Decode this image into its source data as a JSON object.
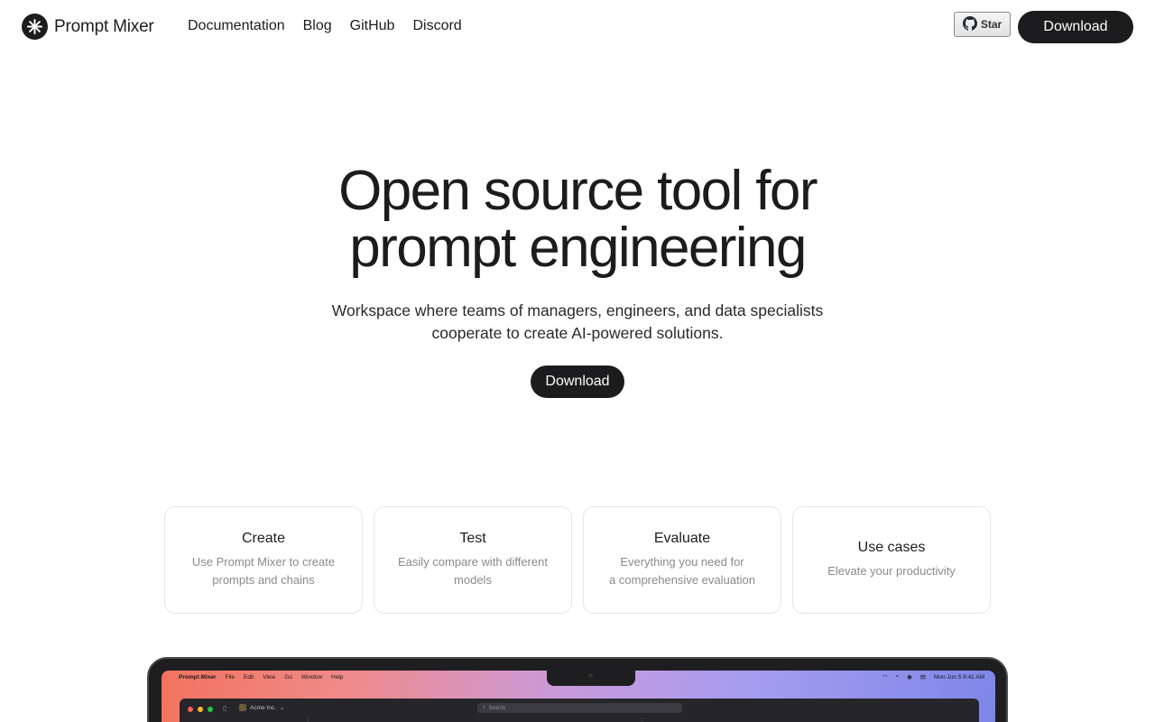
{
  "brand": {
    "name": "Prompt Mixer"
  },
  "nav": [
    {
      "label": "Documentation"
    },
    {
      "label": "Blog"
    },
    {
      "label": "GitHub"
    },
    {
      "label": "Discord"
    }
  ],
  "github_star": {
    "label": "Star",
    "icon": "github-icon"
  },
  "header": {
    "download_label": "Download"
  },
  "hero": {
    "title_line1": "Open source tool for",
    "title_line2": "prompt engineering",
    "subtitle_line1": "Workspace where teams of managers, engineers, and data specialists",
    "subtitle_line2": "cooperate to create AI-powered solutions.",
    "download_label": "Download"
  },
  "cards": [
    {
      "title": "Create",
      "desc_line1": "Use Prompt Mixer to create",
      "desc_line2": "prompts and chains"
    },
    {
      "title": "Test",
      "desc_line1": "Easily compare with different",
      "desc_line2": "models"
    },
    {
      "title": "Evaluate",
      "desc_line1": "Everything you need for",
      "desc_line2": "a comprehensive evaluation"
    },
    {
      "title": "Use cases",
      "desc_line1": "Elevate your productivity",
      "desc_line2": ""
    }
  ],
  "preview": {
    "menubar": {
      "app": "Prompt Mixer",
      "menus": [
        "File",
        "Edit",
        "View",
        "Go",
        "Window",
        "Help"
      ],
      "datetime": "Mon Jun 5  9:41 AM"
    },
    "window": {
      "workspace": "Acme Inc.",
      "search_placeholder": "Search"
    }
  },
  "colors": {
    "primary": "#1c1c1e",
    "text_muted": "#8a8a8e",
    "card_border": "#e6e6e8"
  }
}
